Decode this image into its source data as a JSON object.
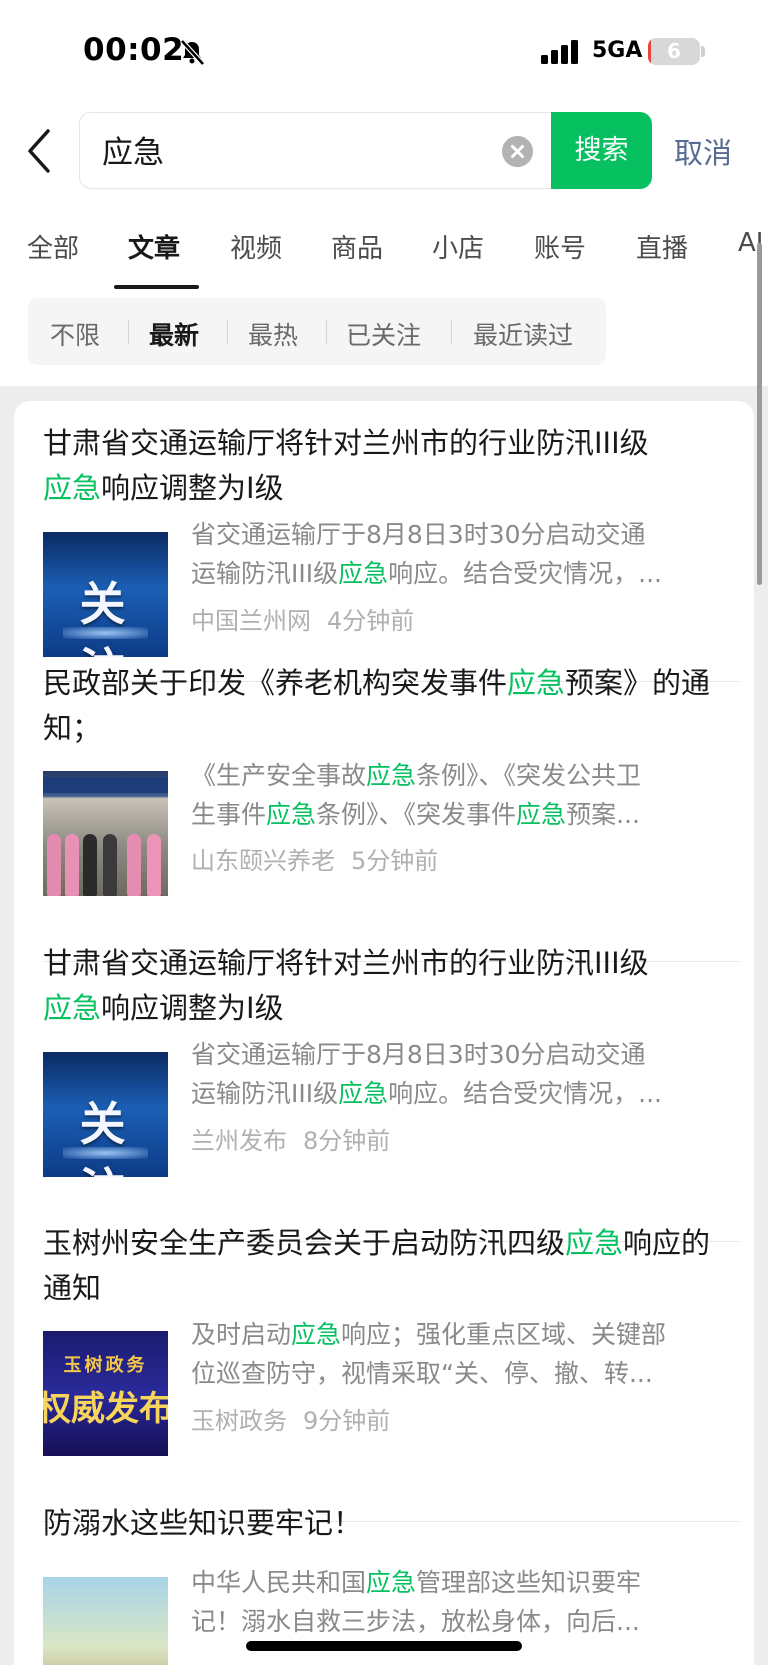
{
  "status_bar": {
    "time": "00:02",
    "network": "5GA",
    "battery": "6",
    "battery_level": 0.06
  },
  "search": {
    "query": "应急",
    "button_label": "搜索",
    "cancel_label": "取消"
  },
  "tabs": [
    {
      "label": "全部"
    },
    {
      "label": "文章"
    },
    {
      "label": "视频"
    },
    {
      "label": "商品"
    },
    {
      "label": "小店"
    },
    {
      "label": "账号"
    },
    {
      "label": "直播"
    },
    {
      "label": "AI"
    }
  ],
  "active_tab": "文章",
  "filters": [
    {
      "label": "不限"
    },
    {
      "label": "最新"
    },
    {
      "label": "最热"
    },
    {
      "label": "已关注"
    },
    {
      "label": "最近读过"
    }
  ],
  "active_filter": "最新",
  "results": [
    {
      "title_pre": "甘肃省交通运输厅将针对兰州市的行业防汛III级",
      "title_hl": "应急",
      "title_post": "响应调整为Ⅰ级",
      "thumb_text": "关 注",
      "snippet_1_pre": "省交通运输厅于8月8日3时30分启动交通",
      "snippet_2_pre": "运输防汛III级",
      "snippet_2_hl": "应急",
      "snippet_2_post": "响应。结合受灾情况，...",
      "source": "中国兰州网",
      "time": "4分钟前"
    },
    {
      "title_pre": "民政部关于印发《养老机构突发事件",
      "title_hl": "应急",
      "title_post": "预案》的通知；",
      "snippet_1_pre": "《生产安全事故",
      "snippet_1_hl": "应急",
      "snippet_1_post": "条例》、《突发公共卫",
      "snippet_2_pre": "生事件",
      "snippet_2_hl": "应急",
      "snippet_2_mid": "条例》、《突发事件",
      "snippet_2_hl2": "应急",
      "snippet_2_post": "预案...",
      "source": "山东颐兴养老",
      "time": "5分钟前"
    },
    {
      "title_pre": "甘肃省交通运输厅将针对兰州市的行业防汛III级",
      "title_hl": "应急",
      "title_post": "响应调整为Ⅰ级",
      "thumb_text": "关 注",
      "snippet_1_pre": "省交通运输厅于8月8日3时30分启动交通",
      "snippet_2_pre": "运输防汛III级",
      "snippet_2_hl": "应急",
      "snippet_2_post": "响应。结合受灾情况，...",
      "source": "兰州发布",
      "time": "8分钟前"
    },
    {
      "title_pre": "玉树州安全生产委员会关于启动防汛四级",
      "title_hl": "应急",
      "title_post": "响应的通知",
      "thumb_top": "玉树政务",
      "thumb_main": "权威发布",
      "snippet_1_pre": "及时启动",
      "snippet_1_hl": "应急",
      "snippet_1_post": "响应；强化重点区域、关键部",
      "snippet_2_pre": "位巡查防守，视情采取“关、停、撤、转...",
      "source": "玉树政务",
      "time": "9分钟前"
    },
    {
      "title_pre": "防溺水这些知识要牢记！",
      "snippet_1_pre": "中华人民共和国",
      "snippet_1_hl": "应急",
      "snippet_1_post": "管理部这些知识要牢",
      "snippet_2_pre": "记！溺水自救三步法，放松身体，向后..."
    }
  ],
  "colors": {
    "accent": "#07c160",
    "link": "#576b95",
    "background": "#ededed"
  }
}
